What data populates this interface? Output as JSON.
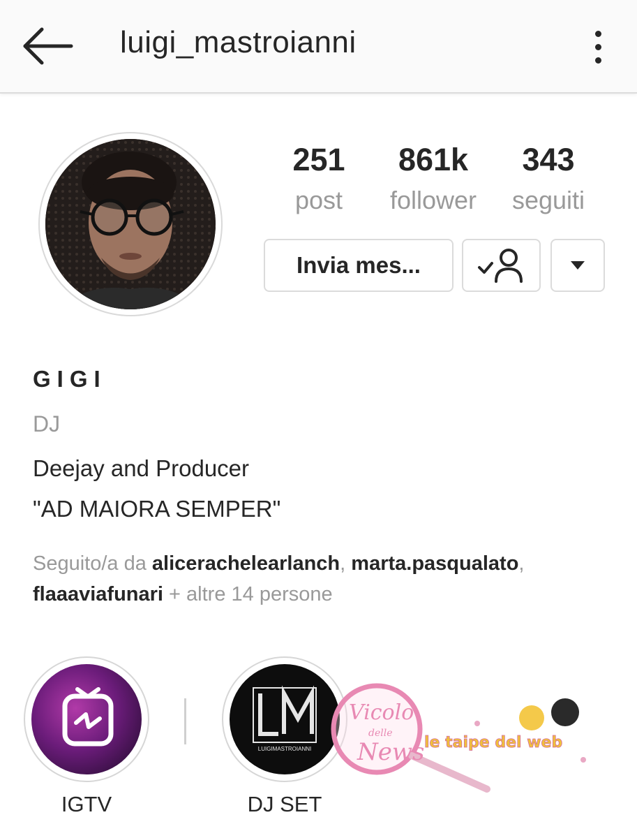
{
  "header": {
    "username": "luigi_mastroianni",
    "back_icon": "arrow-left-icon",
    "more_icon": "more-vertical-icon"
  },
  "stats": [
    {
      "value": "251",
      "label": "post"
    },
    {
      "value": "861k",
      "label": "follower"
    },
    {
      "value": "343",
      "label": "seguiti"
    }
  ],
  "actions": {
    "message_label": "Invia mes...",
    "following_icon": "user-check-icon",
    "dropdown_icon": "caret-down-icon"
  },
  "profile": {
    "display_name": "GIGI",
    "category": "DJ",
    "bio_line1": "Deejay and Producer",
    "bio_line2": "\"AD MAIORA SEMPER\""
  },
  "followed_by": {
    "prefix": "Seguito/a da ",
    "user1": "alicerachelearlanch",
    "sep1": ", ",
    "user2": "marta.pasqualato",
    "sep2": ",",
    "user3": "flaaaviafunari",
    "suffix": " + altre 14 persone"
  },
  "highlights": [
    {
      "label": "IGTV",
      "icon": "igtv-icon"
    },
    {
      "label": "DJ SET",
      "logo_text": "LUIGIMASTROIANNI"
    }
  ],
  "watermark": {
    "text1": "Vicolo",
    "text2": "delle",
    "text3": "News",
    "text4": "le taipe del web"
  },
  "colors": {
    "text_primary": "#262626",
    "text_secondary": "#999999",
    "border": "#dbdbdb",
    "watermark_pink": "#e889b3"
  }
}
